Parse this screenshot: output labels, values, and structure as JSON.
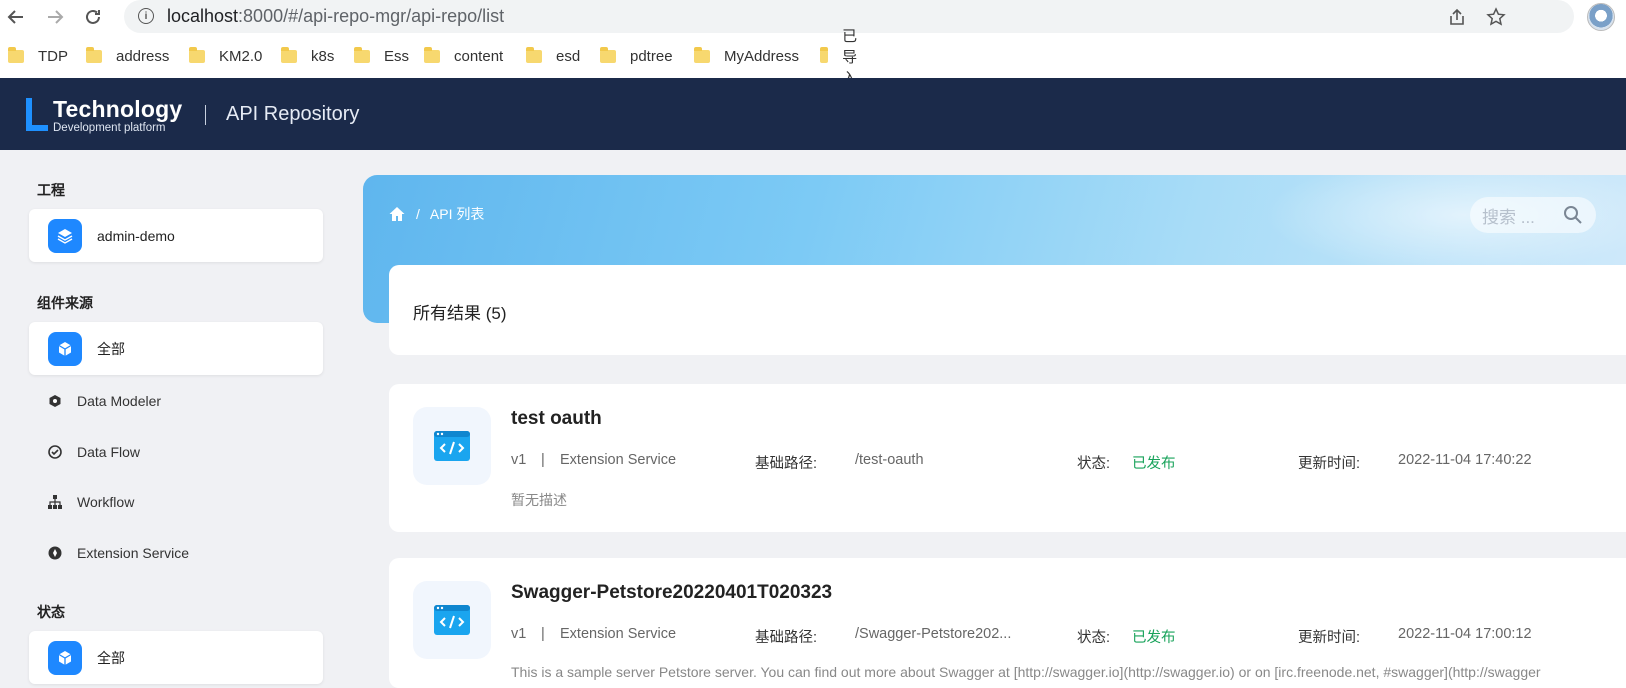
{
  "browser": {
    "url_host": "localhost",
    "url_rest": ":8000/#/api-repo-mgr/api-repo/list",
    "bookmarks": [
      "TDP",
      "address",
      "KM2.0",
      "k8s",
      "Ess",
      "content",
      "esd",
      "pdtree",
      "MyAddress",
      "已导入"
    ]
  },
  "header": {
    "logo_title": "Technology",
    "logo_subtitle": "Development platform",
    "app_name": "API Repository"
  },
  "sidebar": {
    "project_title": "工程",
    "project_name": "admin-demo",
    "source_title": "组件来源",
    "source_all": "全部",
    "source_items": [
      "Data Modeler",
      "Data Flow",
      "Workflow",
      "Extension Service"
    ],
    "status_title": "状态",
    "status_all": "全部"
  },
  "main": {
    "breadcrumb": "API 列表",
    "search_placeholder": "搜索 ...",
    "results_label": "所有结果 (5)",
    "labels": {
      "base_path": "基础路径:",
      "status": "状态:",
      "updated": "更新时间:"
    },
    "apis": [
      {
        "title": "test oauth",
        "version": "v1",
        "sep": "|",
        "type": "Extension Service",
        "base_path": "/test-oauth",
        "status": "已发布",
        "updated": "2022-11-04 17:40:22",
        "description": "暂无描述"
      },
      {
        "title": "Swagger-Petstore20220401T020323",
        "version": "v1",
        "sep": "|",
        "type": "Extension Service",
        "base_path": "/Swagger-Petstore202...",
        "status": "已发布",
        "updated": "2022-11-04 17:00:12",
        "description": "This is a sample server Petstore server. You can find out more about Swagger at [http://swagger.io](http://swagger.io) or on [irc.freenode.net, #swagger](http://swagger"
      }
    ]
  },
  "colors": {
    "header_bg": "#1b2a4a",
    "accent": "#1e88ff",
    "status_green": "#19a35b"
  }
}
